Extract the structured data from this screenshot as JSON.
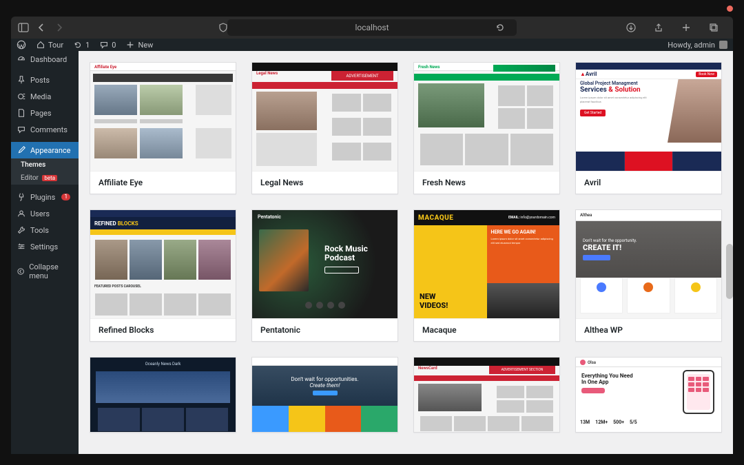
{
  "browser": {
    "url": "localhost"
  },
  "adminbar": {
    "site": "Tour",
    "updates_count": "1",
    "comments_count": "0",
    "new_label": "New",
    "howdy": "Howdy, admin"
  },
  "sidebar": {
    "dashboard": "Dashboard",
    "posts": "Posts",
    "media": "Media",
    "pages": "Pages",
    "comments": "Comments",
    "appearance": "Appearance",
    "themes": "Themes",
    "editor": "Editor",
    "editor_badge": "beta",
    "plugins": "Plugins",
    "plugins_count": "1",
    "users": "Users",
    "tools": "Tools",
    "settings": "Settings",
    "collapse": "Collapse menu"
  },
  "themes": {
    "row1": [
      {
        "name": "Affiliate Eye"
      },
      {
        "name": "Legal News"
      },
      {
        "name": "Fresh News"
      },
      {
        "name": "Avril"
      }
    ],
    "row2": [
      {
        "name": "Refined Blocks"
      },
      {
        "name": "Pentatonic"
      },
      {
        "name": "Macaque"
      },
      {
        "name": "Althea WP"
      }
    ]
  },
  "theme_mock": {
    "avril": {
      "brand": "Avril",
      "headline1": "Global Project Managment",
      "headline2": "Services & Solution",
      "cta": "Get Started",
      "book": "Book Now"
    },
    "pentatonic": {
      "site": "Pentatonic",
      "title1": "Rock Music",
      "title2": "Podcast"
    },
    "macaque": {
      "brand": "MACAQUE",
      "email_lbl": "EMAIL:",
      "email_val": "info@yourdomain.com",
      "hero": "HERE WE GO AGAIN!",
      "box1": "NEW",
      "box2": "VIDEOS!"
    },
    "althea": {
      "brand": "Althea",
      "text1": "Don't wait for the opportunity.",
      "text2": "CREATE IT!"
    },
    "img2": {
      "t1": "Don't wait for opportunities.",
      "t2": "Create them!"
    },
    "affiliate": {
      "brand": "Affiliate Eye"
    },
    "legal": {
      "brand": "Legal News",
      "ad": "ADVERTISEMENT"
    },
    "fresh": {
      "brand": "Fresh News"
    },
    "refined": {
      "brand1": "REFINED",
      "brand2": "BLOCKS",
      "section": "FEATURED POSTS CAROUSEL"
    },
    "newscard": {
      "brand": "NewsCard",
      "ad": "ADVERTISEMENT SECTION"
    },
    "oceanly": {
      "brand": "Oceanly News Dark"
    },
    "olsa": {
      "brand": "Olsa",
      "h1": "Everything You Need",
      "h2": "In One App",
      "s1": "13M",
      "s2": "12M+",
      "s3": "500+",
      "s4": "5/5"
    }
  }
}
